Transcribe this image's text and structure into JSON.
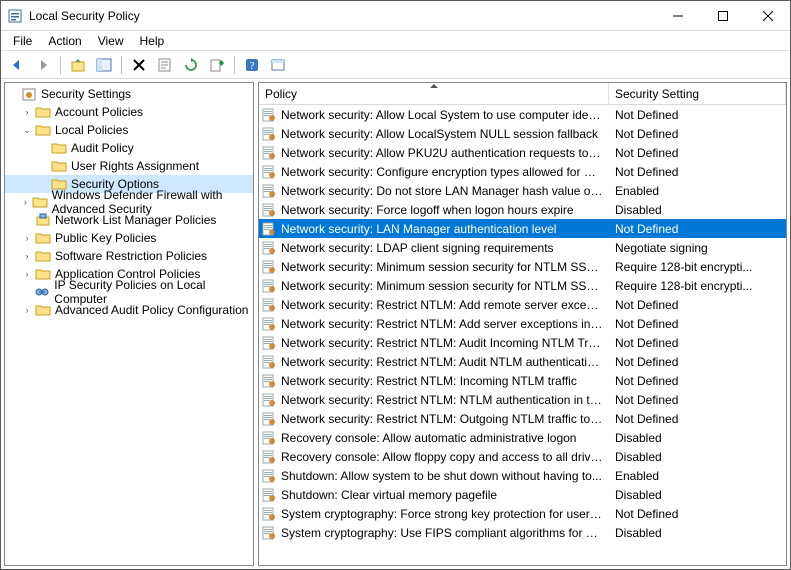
{
  "title": "Local Security Policy",
  "menu": {
    "file": "File",
    "action": "Action",
    "view": "View",
    "help": "Help"
  },
  "toolbar_icons": {
    "back": "back-icon",
    "forward": "forward-icon",
    "up": "up-icon",
    "show": "show-icon",
    "delete": "delete-icon",
    "props": "properties-icon",
    "refresh": "refresh-icon",
    "export": "export-icon",
    "help": "help-icon",
    "extra": "extra-icon"
  },
  "tree": {
    "root": "Security Settings",
    "items": [
      {
        "label": "Account Policies",
        "expandable": true,
        "expanded": false,
        "icon": "folder",
        "depth": 1
      },
      {
        "label": "Local Policies",
        "expandable": true,
        "expanded": true,
        "icon": "folder",
        "depth": 1
      },
      {
        "label": "Audit Policy",
        "expandable": false,
        "icon": "folder",
        "depth": 2
      },
      {
        "label": "User Rights Assignment",
        "expandable": false,
        "icon": "folder",
        "depth": 2
      },
      {
        "label": "Security Options",
        "expandable": false,
        "icon": "folder",
        "depth": 2,
        "selected": true
      },
      {
        "label": "Windows Defender Firewall with Advanced Security",
        "expandable": true,
        "expanded": false,
        "icon": "folder",
        "depth": 1
      },
      {
        "label": "Network List Manager Policies",
        "expandable": false,
        "icon": "folder-net",
        "depth": 1
      },
      {
        "label": "Public Key Policies",
        "expandable": true,
        "expanded": false,
        "icon": "folder",
        "depth": 1
      },
      {
        "label": "Software Restriction Policies",
        "expandable": true,
        "expanded": false,
        "icon": "folder",
        "depth": 1
      },
      {
        "label": "Application Control Policies",
        "expandable": true,
        "expanded": false,
        "icon": "folder",
        "depth": 1
      },
      {
        "label": "IP Security Policies on Local Computer",
        "expandable": false,
        "icon": "ipsec",
        "depth": 1
      },
      {
        "label": "Advanced Audit Policy Configuration",
        "expandable": true,
        "expanded": false,
        "icon": "folder",
        "depth": 1
      }
    ]
  },
  "list": {
    "columns": {
      "policy": "Policy",
      "setting": "Security Setting"
    },
    "rows": [
      {
        "policy": "Network security: Allow Local System to use computer ident...",
        "setting": "Not Defined"
      },
      {
        "policy": "Network security: Allow LocalSystem NULL session fallback",
        "setting": "Not Defined"
      },
      {
        "policy": "Network security: Allow PKU2U authentication requests to t...",
        "setting": "Not Defined"
      },
      {
        "policy": "Network security: Configure encryption types allowed for Ke...",
        "setting": "Not Defined"
      },
      {
        "policy": "Network security: Do not store LAN Manager hash value on ...",
        "setting": "Enabled"
      },
      {
        "policy": "Network security: Force logoff when logon hours expire",
        "setting": "Disabled"
      },
      {
        "policy": "Network security: LAN Manager authentication level",
        "setting": "Not Defined",
        "selected": true
      },
      {
        "policy": "Network security: LDAP client signing requirements",
        "setting": "Negotiate signing"
      },
      {
        "policy": "Network security: Minimum session security for NTLM SSP ...",
        "setting": "Require 128-bit encrypti..."
      },
      {
        "policy": "Network security: Minimum session security for NTLM SSP ...",
        "setting": "Require 128-bit encrypti..."
      },
      {
        "policy": "Network security: Restrict NTLM: Add remote server excepti...",
        "setting": "Not Defined"
      },
      {
        "policy": "Network security: Restrict NTLM: Add server exceptions in t...",
        "setting": "Not Defined"
      },
      {
        "policy": "Network security: Restrict NTLM: Audit Incoming NTLM Tra...",
        "setting": "Not Defined"
      },
      {
        "policy": "Network security: Restrict NTLM: Audit NTLM authenticatio...",
        "setting": "Not Defined"
      },
      {
        "policy": "Network security: Restrict NTLM: Incoming NTLM traffic",
        "setting": "Not Defined"
      },
      {
        "policy": "Network security: Restrict NTLM: NTLM authentication in th...",
        "setting": "Not Defined"
      },
      {
        "policy": "Network security: Restrict NTLM: Outgoing NTLM traffic to ...",
        "setting": "Not Defined"
      },
      {
        "policy": "Recovery console: Allow automatic administrative logon",
        "setting": "Disabled"
      },
      {
        "policy": "Recovery console: Allow floppy copy and access to all drives...",
        "setting": "Disabled"
      },
      {
        "policy": "Shutdown: Allow system to be shut down without having to...",
        "setting": "Enabled"
      },
      {
        "policy": "Shutdown: Clear virtual memory pagefile",
        "setting": "Disabled"
      },
      {
        "policy": "System cryptography: Force strong key protection for user k...",
        "setting": "Not Defined"
      },
      {
        "policy": "System cryptography: Use FIPS compliant algorithms for en...",
        "setting": "Disabled"
      }
    ]
  }
}
